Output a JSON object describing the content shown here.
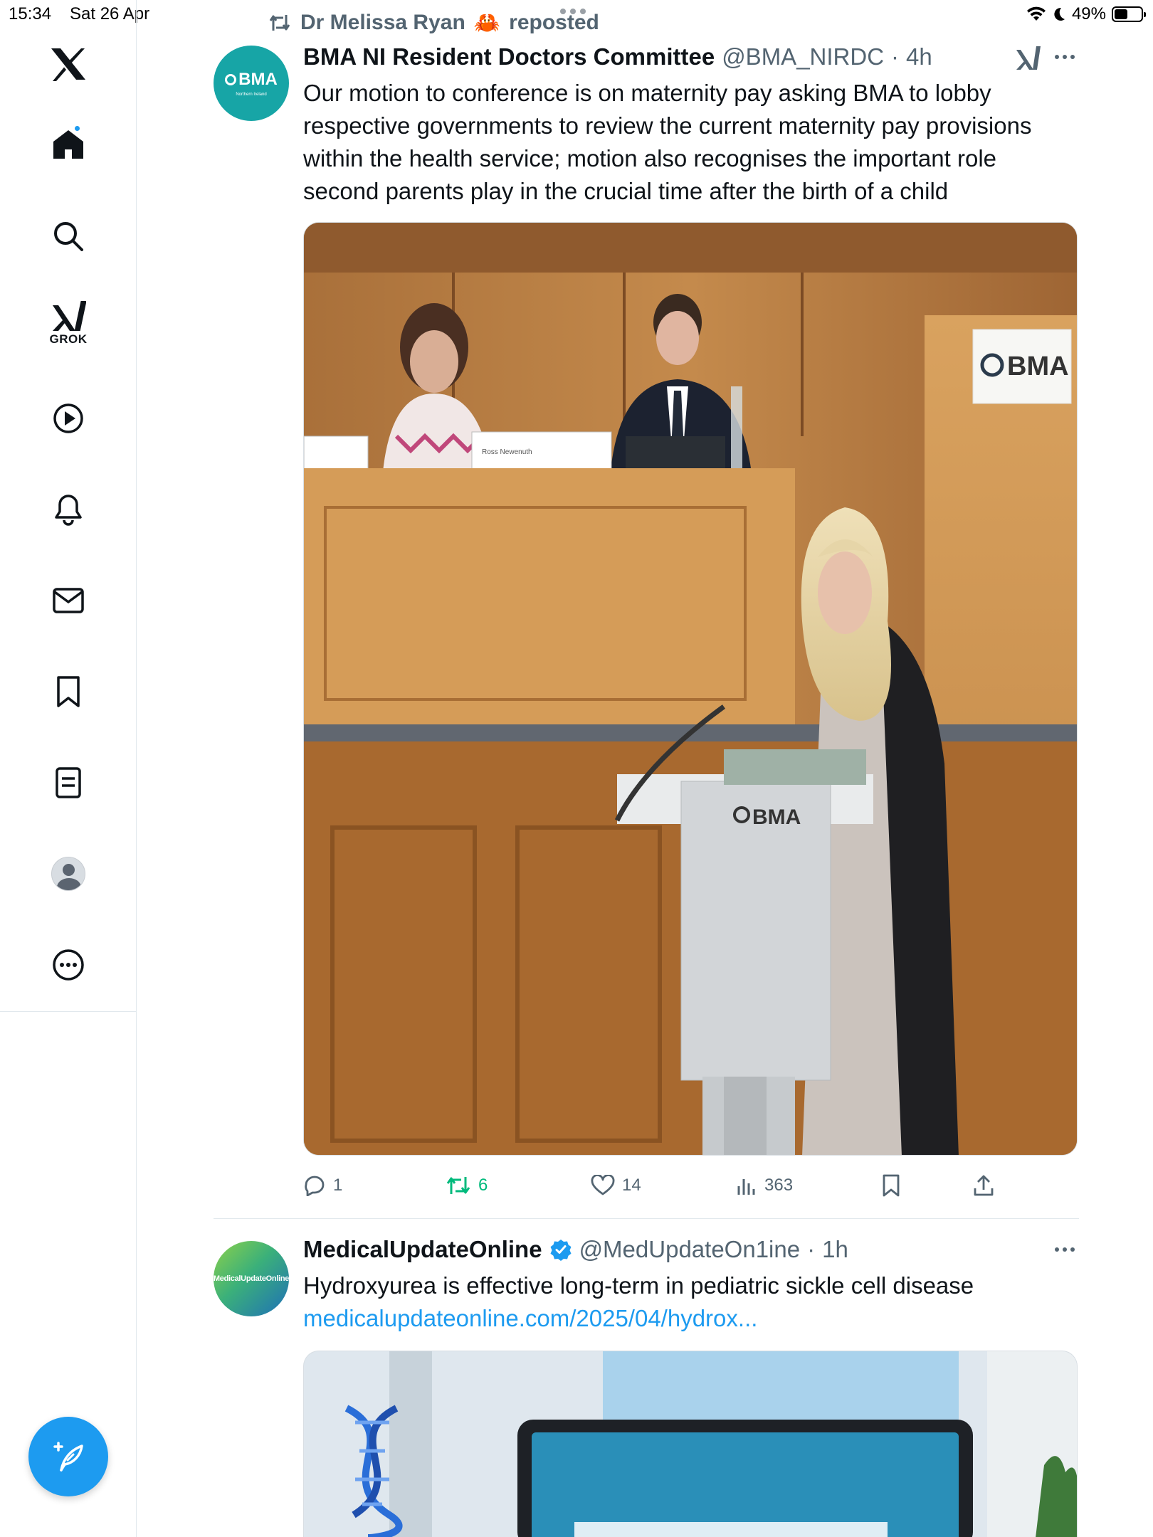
{
  "status_bar": {
    "time": "15:34",
    "date": "Sat 26 Apr",
    "battery": "49%",
    "battery_level": 0.49
  },
  "nav": {
    "grok_label": "GROK",
    "items": [
      "x-logo",
      "home",
      "search",
      "grok",
      "video",
      "notifications",
      "messages",
      "bookmarks",
      "lists",
      "profile",
      "more"
    ]
  },
  "repost": {
    "user": "Dr Melissa Ryan",
    "emoji": "🦀",
    "label": "reposted"
  },
  "tweet1": {
    "avatar_logo": "BMA",
    "avatar_sub": "Northern Ireland",
    "name": "BMA NI Resident Doctors Committee",
    "handle": "@BMA_NIRDC",
    "separator": "·",
    "time": "4h",
    "lines": [
      "Our motion to conference is on maternity pay asking BMA to lobby",
      "respective  governments to review the current maternity pay provisions",
      "within the health service; motion also recognises the important role",
      "second parents play in the crucial time after the birth of a child"
    ],
    "photo": {
      "sign_back": "BMA",
      "podium_logo": "BMA",
      "nameplate": "Ross Newenuth"
    },
    "stats": {
      "replies": "1",
      "reposts": "6",
      "likes": "14",
      "views": "363"
    }
  },
  "tweet2": {
    "avatar_text": "MedicalUpdateOnline",
    "name": "MedicalUpdateOnline",
    "handle": "@MedUpdateOn1ine",
    "separator": "·",
    "time": "1h",
    "text": "Hydroxyurea is effective long-term in pediatric sickle cell disease",
    "link": "medicalupdateonline.com/2025/04/hydrox..."
  },
  "colors": {
    "accent": "#1d9bf0",
    "repost_green": "#00ba7c",
    "secondary_text": "#536471",
    "bma_teal": "#17a5a6"
  }
}
